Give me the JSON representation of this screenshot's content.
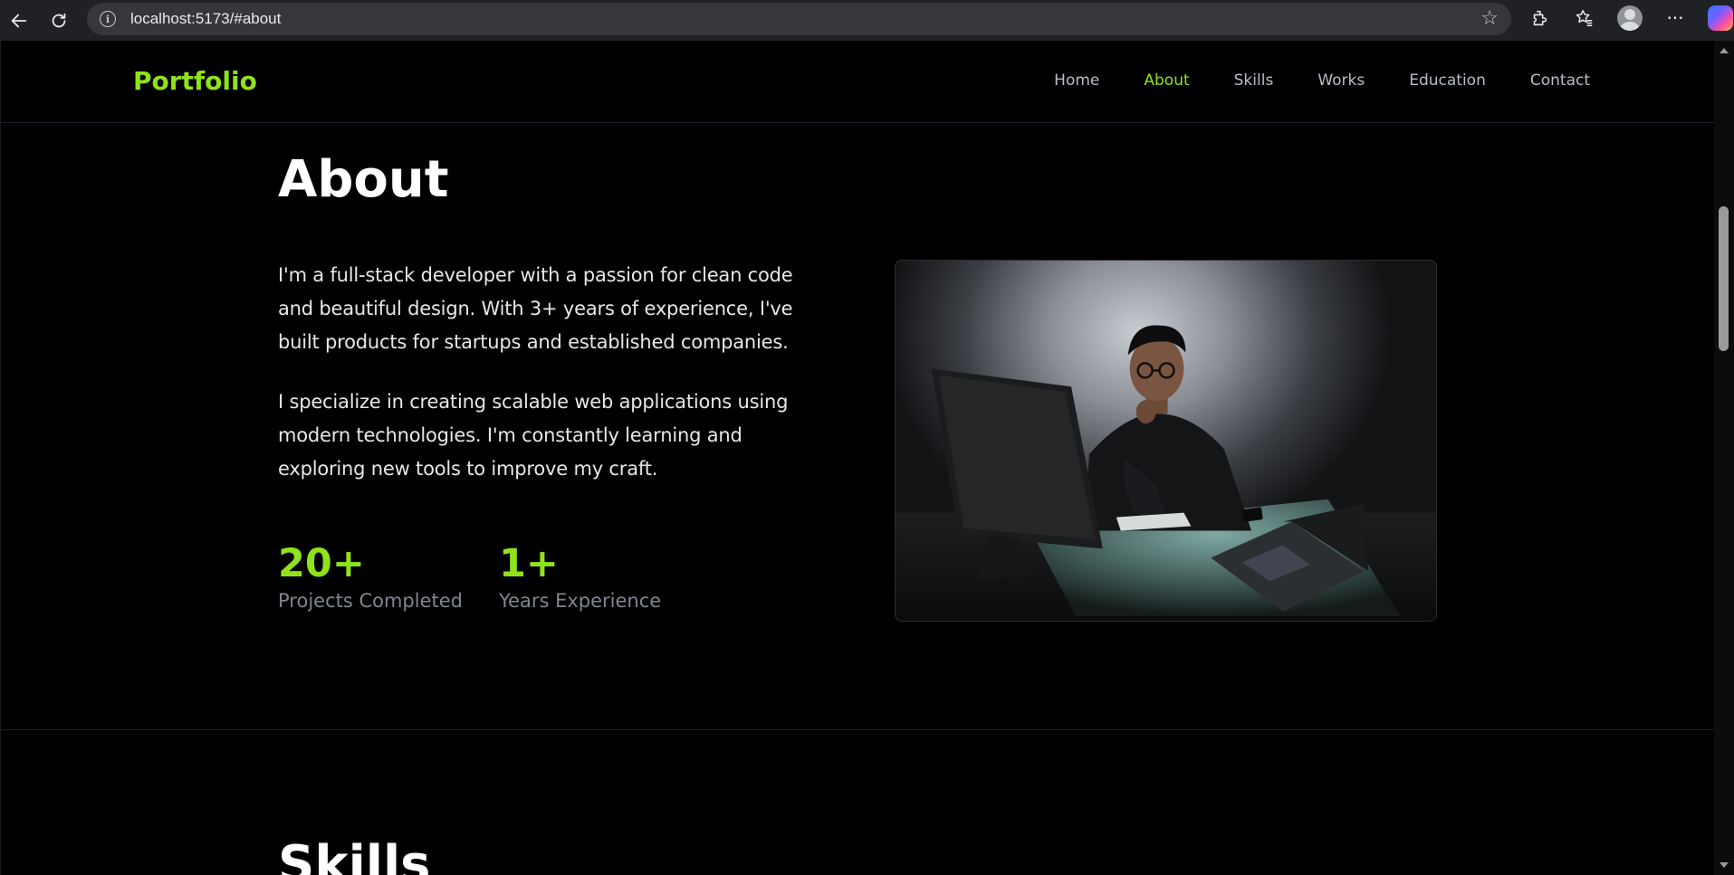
{
  "browser": {
    "url": "localhost:5173/#about"
  },
  "header": {
    "logo": "Portfolio",
    "nav": [
      {
        "label": "Home"
      },
      {
        "label": "About"
      },
      {
        "label": "Skills"
      },
      {
        "label": "Works"
      },
      {
        "label": "Education"
      },
      {
        "label": "Contact"
      }
    ],
    "active_nav": "About"
  },
  "about": {
    "title": "About",
    "paragraphs": [
      "I'm a full-stack developer with a passion for clean code and beautiful design. With 3+ years of experience, I've built products for startups and established companies.",
      "I specialize in creating scalable web applications using modern technologies. I'm constantly learning and exploring new tools to improve my craft."
    ],
    "stats": [
      {
        "value": "20+",
        "label": "Projects Completed"
      },
      {
        "value": "1+",
        "label": "Years Experience"
      }
    ]
  },
  "skills": {
    "title": "Skills"
  },
  "colors": {
    "accent": "#8fe31b",
    "background": "#000000",
    "muted_text": "#7e8593"
  }
}
